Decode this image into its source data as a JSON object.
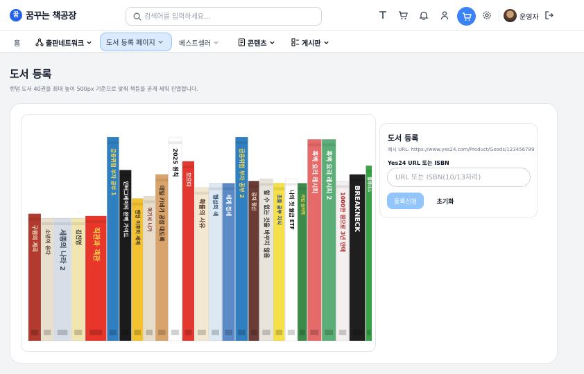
{
  "app": {
    "logo_char": "꿈",
    "title": "꿈꾸는 책공장"
  },
  "search": {
    "placeholder": "검색어를 입력하세요..."
  },
  "header_icons": [
    "text-icon",
    "cart-icon",
    "bell-icon",
    "user-icon",
    "cart-icon",
    "gear-icon",
    "logout-icon"
  ],
  "user": {
    "name": "운영자"
  },
  "nav": {
    "home": "홈",
    "publishing": "출판네트워크",
    "register": "도서 등록 페이지",
    "bestseller": "베스트셀러",
    "contents": "콘텐츠",
    "board": "게시판"
  },
  "page": {
    "title": "도서 등록",
    "subtitle": "랜덤 도서 40권을 최대 높이 500px 기준으로 맞춰 책등을 곧게 세워 진열합니다."
  },
  "form": {
    "title": "도서 등록",
    "example": "예시 URL: https://www.yes24.com/Product/Goods/123456789",
    "label": "Yes24 URL 또는 ISBN",
    "placeholder": "URL 또는 ISBN(10/13자리)",
    "submit": "등록신청",
    "reset": "초기화"
  },
  "shelf": {
    "books": [
      {
        "title": "구원의 계곡",
        "height": 0.58,
        "color": "#b23a2e",
        "text_color": "#f5e6c8"
      },
      {
        "title": "소년이 온다",
        "height": 0.56,
        "color": "#e8e0cc",
        "text_color": "#4a3b2a"
      },
      {
        "title": "세종의 나라 2",
        "height": 0.56,
        "color": "#d7dee8",
        "text_color": "#3a4a5c"
      },
      {
        "title": "김진명",
        "height": 0.56,
        "color": "#f2e6b0",
        "text_color": "#333"
      },
      {
        "title": "직관과 객관",
        "height": 0.57,
        "color": "#e8362b",
        "text_color": "#f7d94c"
      },
      {
        "title": "금융위험 부자 공부 1",
        "height": 0.93,
        "color": "#2f7fc1",
        "text_color": "#f7d94c"
      },
      {
        "title": "인터그레이티 완벽 가이드",
        "height": 0.78,
        "color": "#1b1b1b",
        "text_color": "#ffffff"
      },
      {
        "title": "엔딩 이후의 세계",
        "height": 0.65,
        "color": "#f2c230",
        "text_color": "#2b2b2b"
      },
      {
        "title": "여기서 나가",
        "height": 0.66,
        "color": "#e7ddc9",
        "text_color": "#7a2a2a"
      },
      {
        "title": "데일 카네기 공정 대도록",
        "height": 0.76,
        "color": "#d9a46b",
        "text_color": "#3a2a1a"
      },
      {
        "title": "2025 원칙",
        "height": 0.93,
        "color": "#ffffff",
        "text_color": "#111111"
      },
      {
        "title": "모으다",
        "height": 0.82,
        "color": "#e2382f",
        "text_color": "#ffffff"
      },
      {
        "title": "확률의 사유",
        "height": 0.7,
        "color": "#f3e9d2",
        "text_color": "#5a3a2a"
      },
      {
        "title": "행성의 색",
        "height": 0.72,
        "color": "#dce8f2",
        "text_color": "#2a4a6a"
      },
      {
        "title": "세계 정세",
        "height": 0.72,
        "color": "#5b8ac6",
        "text_color": "#ffffff"
      },
      {
        "title": "금융위험 부자 공부 2",
        "height": 0.93,
        "color": "#2f7fc1",
        "text_color": "#f7d94c"
      },
      {
        "title": "김재 정신",
        "height": 0.73,
        "color": "#6b3b35",
        "text_color": "#f2e6c8"
      },
      {
        "title": "할 수 없는 것을 바꾸지 않음",
        "height": 0.74,
        "color": "#e8e4dc",
        "text_color": "#333333"
      },
      {
        "title": "초등 공부 지식",
        "height": 0.72,
        "color": "#f5e049",
        "text_color": "#1f3a8a"
      },
      {
        "title": "나의 첫 월급 ETF",
        "height": 0.74,
        "color": "#ffffff",
        "text_color": "#111111"
      },
      {
        "title": "리얼 심리학",
        "height": 0.72,
        "color": "#3c8a4a",
        "text_color": "#f7d94c"
      },
      {
        "title": "흑백 요리 레시피",
        "height": 0.92,
        "color": "#e56a6a",
        "text_color": "#ffffff"
      },
      {
        "title": "흑백 요리 레시피 2",
        "height": 0.92,
        "color": "#5cae78",
        "text_color": "#ffffff"
      },
      {
        "title": "1000만 원으로 3년 만에",
        "height": 0.73,
        "color": "#f5f0f0",
        "text_color": "#b02a2a"
      },
      {
        "title": "BREAKNECK",
        "height": 0.76,
        "color": "#1f1f1f",
        "text_color": "#ffffff"
      },
      {
        "title": "플래너스",
        "height": 0.8,
        "color": "#3aa34a",
        "text_color": "#ffffff"
      }
    ]
  }
}
